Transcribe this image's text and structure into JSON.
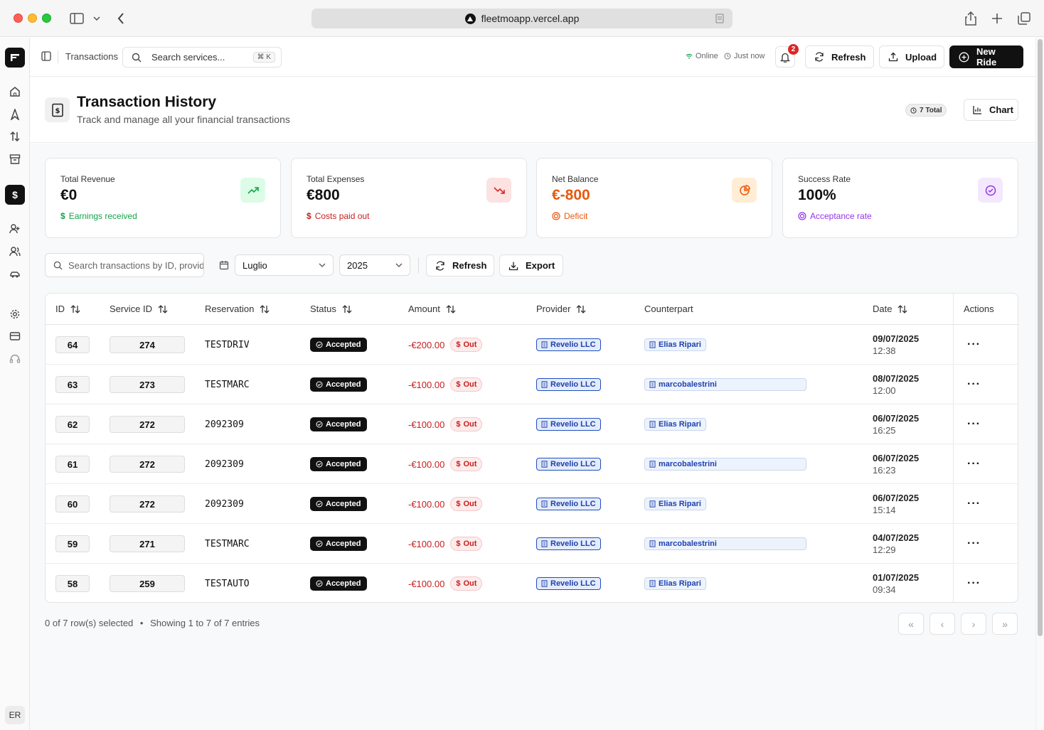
{
  "browser": {
    "url": "fleetmoapp.vercel.app"
  },
  "sidebar": {
    "items": [
      {
        "icon": "home-icon"
      },
      {
        "icon": "navigation-icon"
      },
      {
        "icon": "arrows-up-down-icon"
      },
      {
        "icon": "archive-icon"
      },
      {
        "icon": "dollar-icon",
        "label": "$",
        "active": true
      },
      {
        "icon": "user-plus-icon"
      },
      {
        "icon": "users-icon"
      },
      {
        "icon": "car-icon"
      },
      {
        "icon": "settings-icon"
      },
      {
        "icon": "credit-card-icon"
      },
      {
        "icon": "headset-icon"
      }
    ],
    "avatar": "ER"
  },
  "topbar": {
    "breadcrumb": "Transactions",
    "search_placeholder": "Search services...",
    "shortcut": "⌘ K",
    "online": "Online",
    "last_update": "Just now",
    "notifications_count": "2",
    "refresh_label": "Refresh",
    "upload_label": "Upload",
    "new_ride_label": "New Ride"
  },
  "header": {
    "title": "Transaction History",
    "subtitle": "Track and manage all your financial transactions",
    "total_badge": "7 Total",
    "chart_label": "Chart"
  },
  "cards": [
    {
      "label": "Total Revenue",
      "value": "€0",
      "sub": "Earnings received",
      "color": "#16a34a",
      "icon": "trending-up-icon",
      "icon_bg": "#dcfce7"
    },
    {
      "label": "Total Expenses",
      "value": "€800",
      "sub": "Costs paid out",
      "color": "#dc2626",
      "icon": "trending-down-icon",
      "icon_bg": "#fde2e2"
    },
    {
      "label": "Net Balance",
      "value": "€-800",
      "sub": "Deficit",
      "color": "#ea580c",
      "icon": "pie-chart-icon",
      "icon_bg": "#ffedd5"
    },
    {
      "label": "Success Rate",
      "value": "100%",
      "sub": "Acceptance rate",
      "color": "#9333ea",
      "icon": "check-circle-icon",
      "icon_bg": "#f3e8ff"
    }
  ],
  "filters": {
    "search_placeholder": "Search transactions by ID, provider...",
    "month": "Luglio",
    "year": "2025",
    "refresh_label": "Refresh",
    "export_label": "Export"
  },
  "table": {
    "columns": [
      "ID",
      "Service ID",
      "Reservation",
      "Status",
      "Amount",
      "Provider",
      "Counterpart",
      "Date",
      "Actions"
    ],
    "rows": [
      {
        "id": "64",
        "service_id": "274",
        "reservation": "TESTDRIV",
        "status": "Accepted",
        "amount": "-€200.00",
        "direction": "Out",
        "provider": "Revelio LLC",
        "counterpart": "Elias Ripari",
        "date": "09/07/2025",
        "time": "12:38"
      },
      {
        "id": "63",
        "service_id": "273",
        "reservation": "TESTMARC",
        "status": "Accepted",
        "amount": "-€100.00",
        "direction": "Out",
        "provider": "Revelio LLC",
        "counterpart": "marcobalestrini",
        "date": "08/07/2025",
        "time": "12:00"
      },
      {
        "id": "62",
        "service_id": "272",
        "reservation": "2092309",
        "status": "Accepted",
        "amount": "-€100.00",
        "direction": "Out",
        "provider": "Revelio LLC",
        "counterpart": "Elias Ripari",
        "date": "06/07/2025",
        "time": "16:25"
      },
      {
        "id": "61",
        "service_id": "272",
        "reservation": "2092309",
        "status": "Accepted",
        "amount": "-€100.00",
        "direction": "Out",
        "provider": "Revelio LLC",
        "counterpart": "marcobalestrini",
        "date": "06/07/2025",
        "time": "16:23"
      },
      {
        "id": "60",
        "service_id": "272",
        "reservation": "2092309",
        "status": "Accepted",
        "amount": "-€100.00",
        "direction": "Out",
        "provider": "Revelio LLC",
        "counterpart": "Elias Ripari",
        "date": "06/07/2025",
        "time": "15:14"
      },
      {
        "id": "59",
        "service_id": "271",
        "reservation": "TESTMARC",
        "status": "Accepted",
        "amount": "-€100.00",
        "direction": "Out",
        "provider": "Revelio LLC",
        "counterpart": "marcobalestrini",
        "date": "04/07/2025",
        "time": "12:29"
      },
      {
        "id": "58",
        "service_id": "259",
        "reservation": "TESTAUTO",
        "status": "Accepted",
        "amount": "-€100.00",
        "direction": "Out",
        "provider": "Revelio LLC",
        "counterpart": "Elias Ripari",
        "date": "01/07/2025",
        "time": "09:34"
      }
    ],
    "actions_label": "···"
  },
  "footer": {
    "selection": "0 of 7 row(s) selected",
    "separator": "•",
    "entries": "Showing 1 to 7 of 7 entries"
  }
}
